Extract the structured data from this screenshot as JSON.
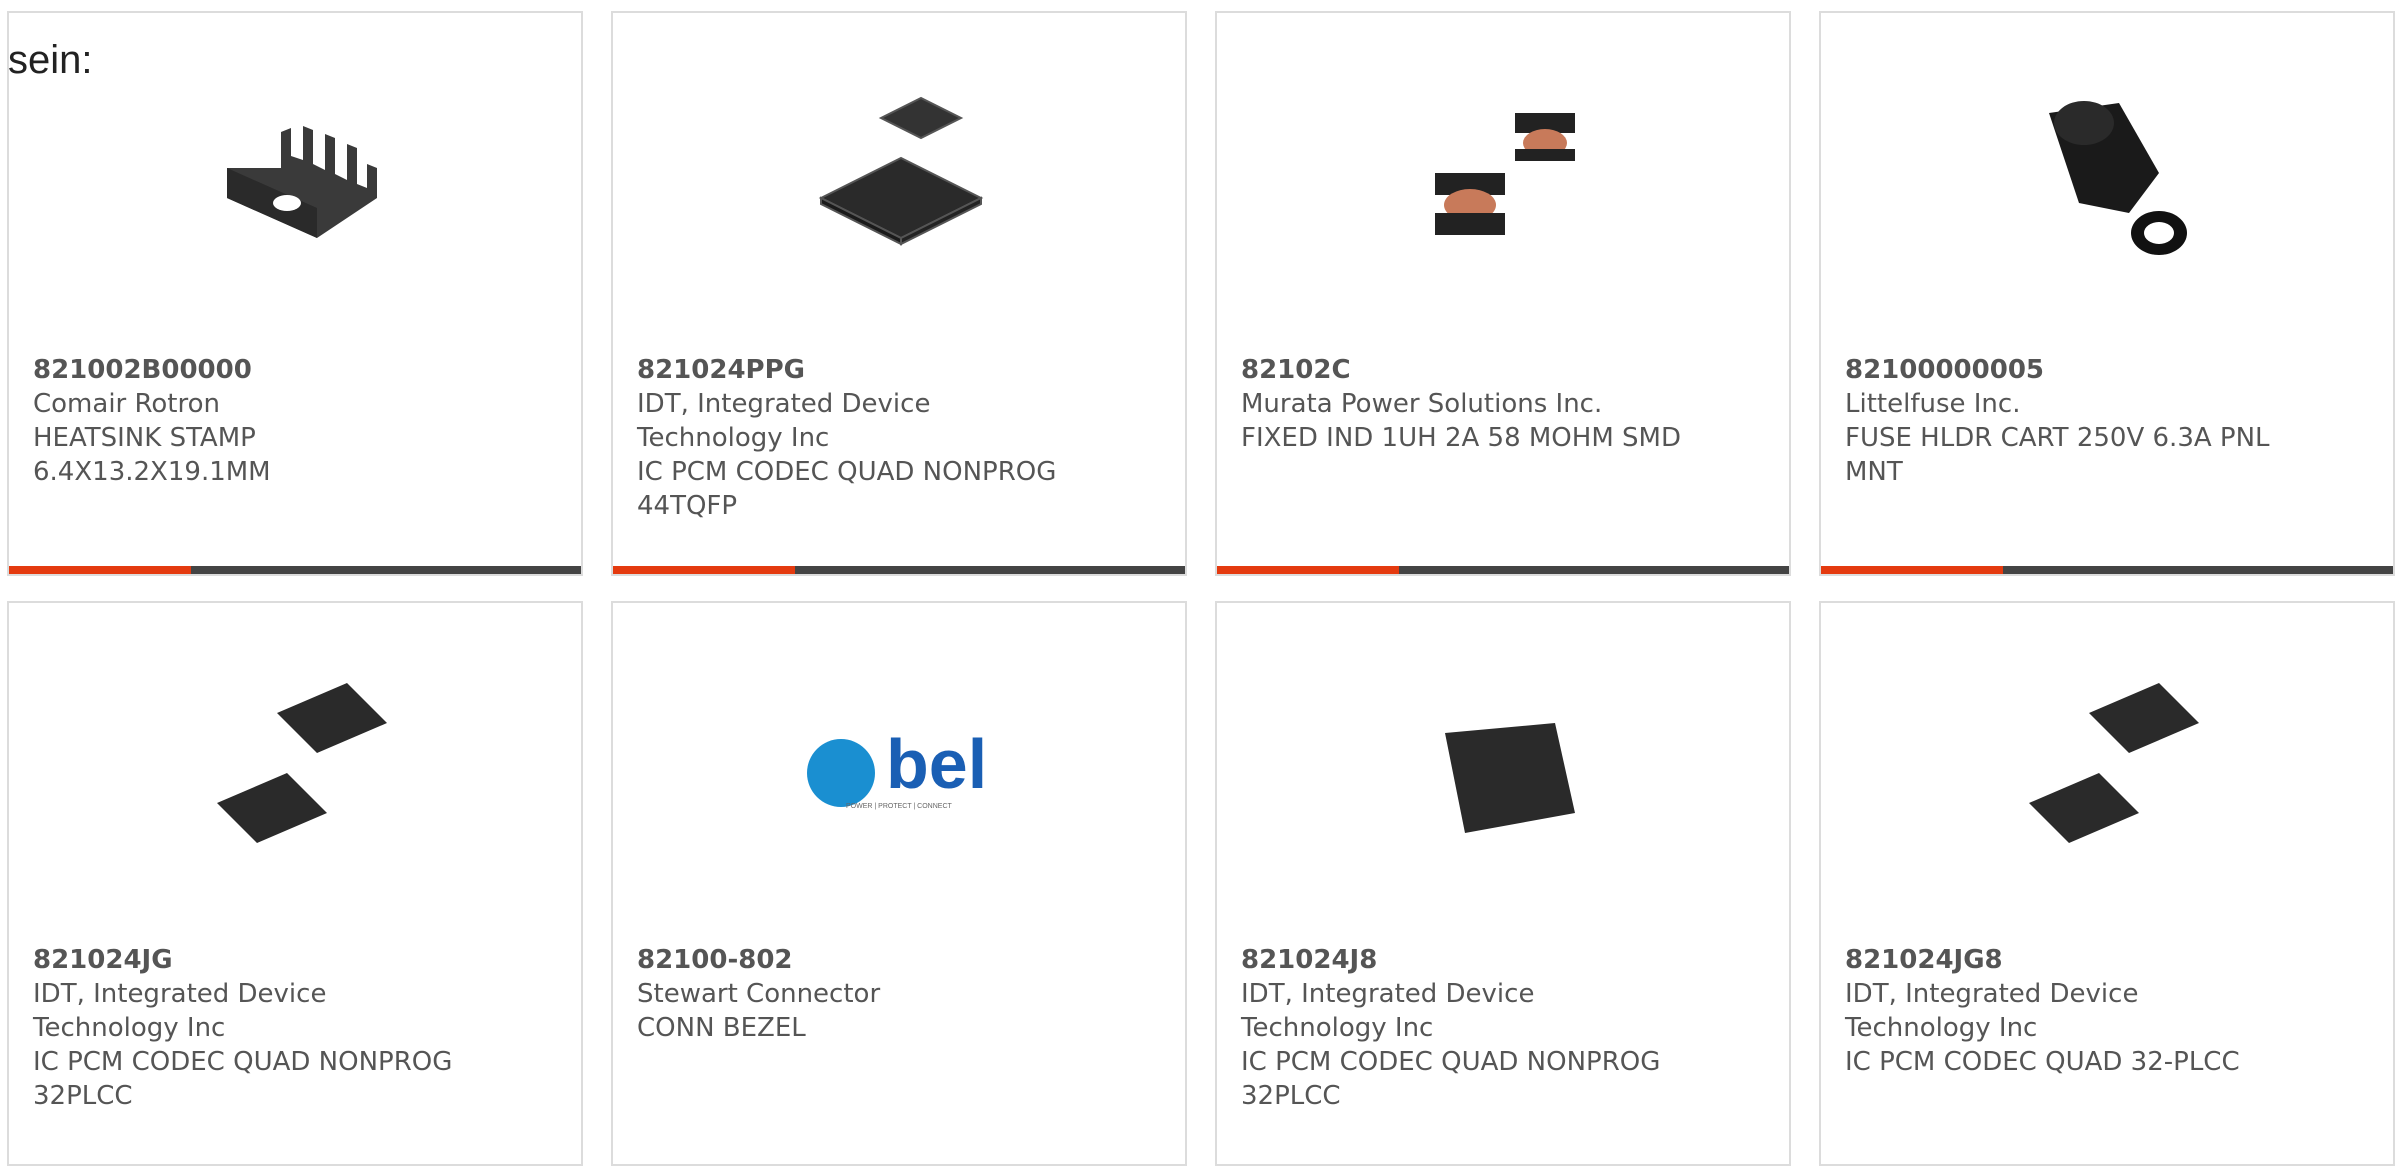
{
  "page": {
    "stray_text": "sein:"
  },
  "colors": {
    "accent": "#e43a0f",
    "bar": "#444444",
    "border": "#dcdcdc",
    "text": "#555555"
  },
  "products": [
    {
      "part": "821002B00000",
      "manufacturer": "Comair Rotron",
      "description": "HEATSINK STAMP 6.4X13.2X19.1MM",
      "icon": "heatsink-icon"
    },
    {
      "part": "821024PPG",
      "manufacturer": "IDT, Integrated Device Technology Inc",
      "description": "IC PCM CODEC QUAD NONPROG 44TQFP",
      "icon": "tqfp-chip-icon"
    },
    {
      "part": "82102C",
      "manufacturer": "Murata Power Solutions Inc.",
      "description": "FIXED IND 1UH 2A 58 MOHM SMD",
      "icon": "inductor-icon"
    },
    {
      "part": "82100000005",
      "manufacturer": "Littelfuse Inc.",
      "description": "FUSE HLDR CART 250V 6.3A PNL MNT",
      "icon": "fuse-holder-icon"
    },
    {
      "part": "821024JG",
      "manufacturer": "IDT, Integrated Device Technology Inc",
      "description": "IC PCM CODEC QUAD NONPROG 32PLCC",
      "icon": "plcc-chip-icon"
    },
    {
      "part": "82100-802",
      "manufacturer": "Stewart Connector",
      "description": "CONN BEZEL",
      "icon": "bel-logo",
      "logo_text": "bel",
      "logo_tagline": "POWER | PROTECT | CONNECT"
    },
    {
      "part": "821024J8",
      "manufacturer": "IDT, Integrated Device Technology Inc",
      "description": "IC PCM CODEC QUAD NONPROG 32PLCC",
      "icon": "plcc-chip-icon"
    },
    {
      "part": "821024JG8",
      "manufacturer": "IDT, Integrated Device Technology Inc",
      "description": "IC PCM CODEC QUAD 32-PLCC",
      "icon": "plcc-chip-icon"
    }
  ]
}
